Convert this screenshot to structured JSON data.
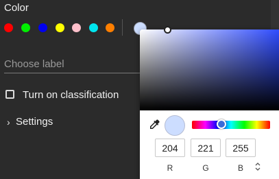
{
  "color_section": {
    "title": "Color",
    "swatches": [
      {
        "name": "red",
        "color": "#ff0000"
      },
      {
        "name": "green",
        "color": "#00ee00"
      },
      {
        "name": "blue",
        "color": "#0000ee"
      },
      {
        "name": "yellow",
        "color": "#ffff00"
      },
      {
        "name": "pink",
        "color": "#ffc0cb"
      },
      {
        "name": "cyan",
        "color": "#00e5ee"
      },
      {
        "name": "orange",
        "color": "#ff7f00"
      }
    ],
    "selected_color": "#ccddff"
  },
  "label_input": {
    "placeholder": "Choose label",
    "value": ""
  },
  "classification": {
    "label": "Turn on classification",
    "checked": false
  },
  "settings": {
    "label": "Settings",
    "chevron": "›"
  },
  "color_picker": {
    "rgb": {
      "r": "204",
      "g": "221",
      "b": "255"
    },
    "labels": {
      "r": "R",
      "g": "G",
      "b": "B"
    },
    "mode_toggle_icon": "⌃⌄",
    "hue_fraction": 0.38,
    "eyedropper_icon": "eyedropper-icon"
  }
}
